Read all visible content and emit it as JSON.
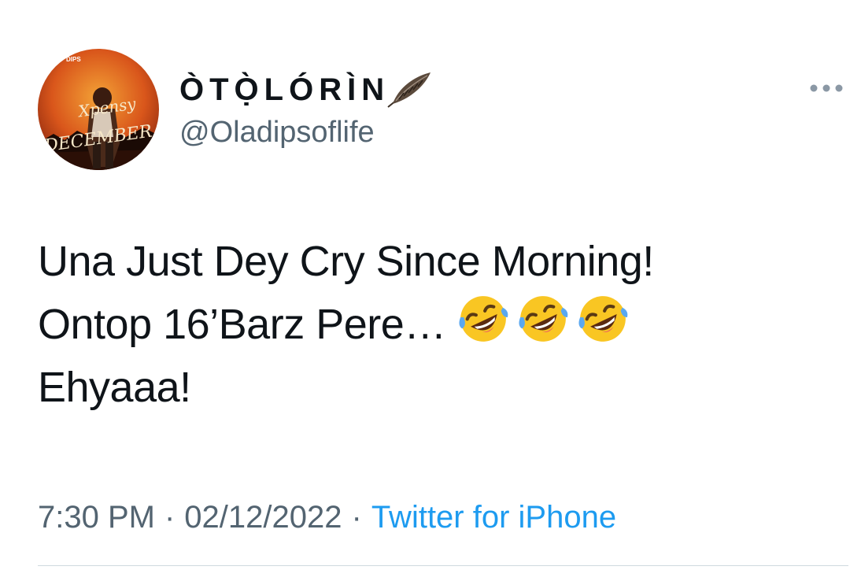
{
  "author": {
    "display_name": "ÒTỌ̀LÓRÌN",
    "handle": "@Oladipsoflife",
    "avatar_art_text": {
      "top": "DIPS",
      "title_script": "Xpensy",
      "subtitle_script": "DECEMBER"
    }
  },
  "tweet": {
    "lines": [
      "Una Just Dey Cry Since Morning!",
      "Ontop 16’Barz Pere…",
      "Ehyaaa!"
    ],
    "emojis": [
      "rolling-on-floor-laughing",
      "rolling-on-floor-laughing",
      "rolling-on-floor-laughing"
    ],
    "time": "7:30 PM",
    "date": "02/12/2022",
    "separator": "·",
    "source": "Twitter for iPhone"
  },
  "colors": {
    "text": "#0f1419",
    "secondary": "#536471",
    "link": "#1d9bf0",
    "divider": "#cfd9de"
  }
}
